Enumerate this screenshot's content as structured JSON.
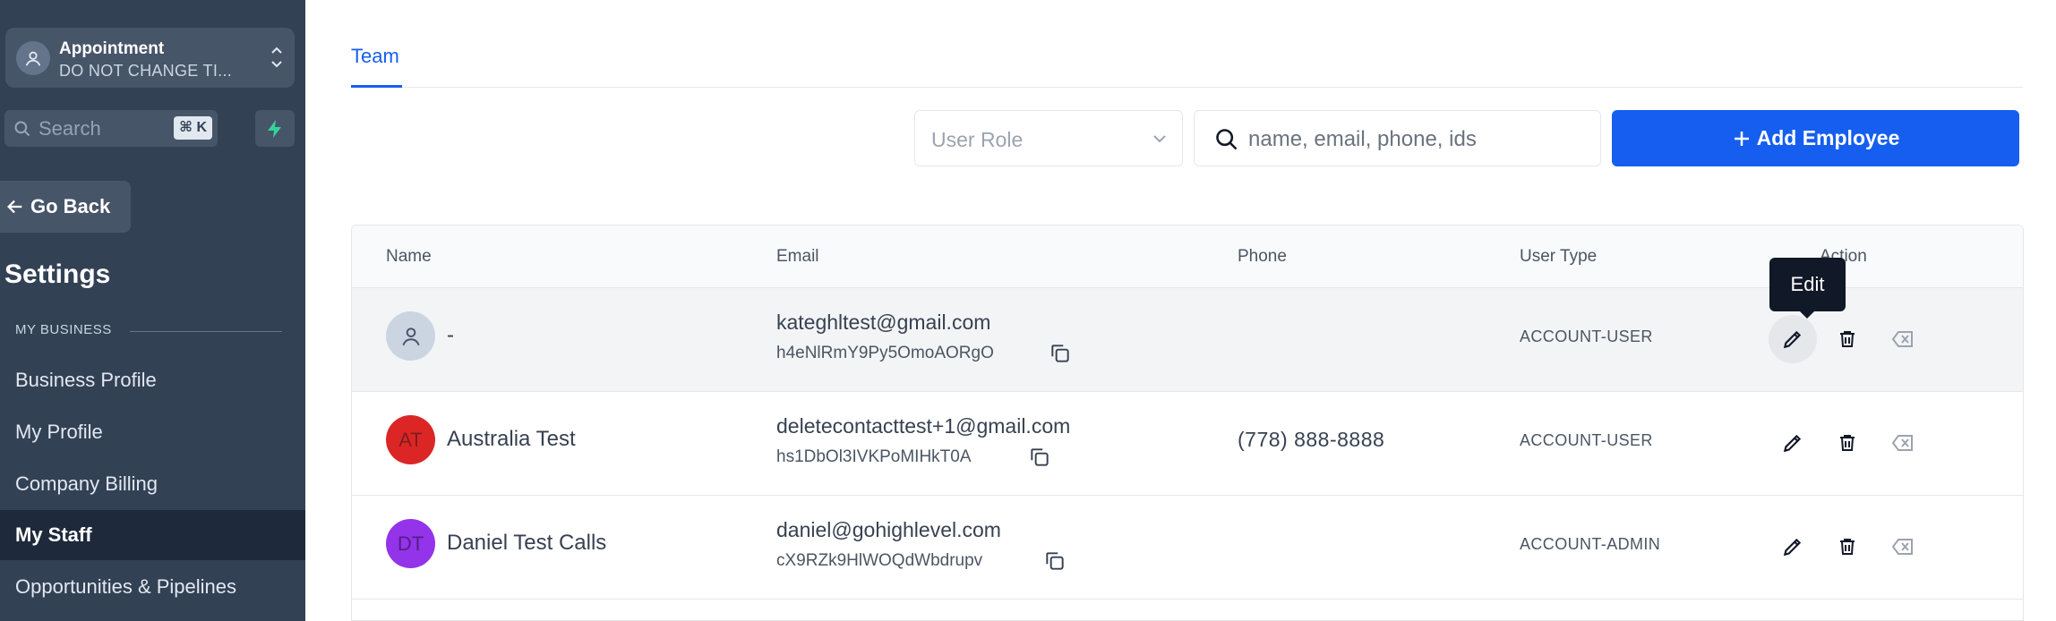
{
  "account": {
    "name": "Appointment",
    "subtitle": "DO NOT CHANGE TI..."
  },
  "search": {
    "placeholder": "Search",
    "shortcut": "⌘ K"
  },
  "nav": {
    "go_back": "Go Back",
    "settings_title": "Settings",
    "section_label": "MY BUSINESS",
    "items": [
      {
        "label": "Business Profile"
      },
      {
        "label": "My Profile"
      },
      {
        "label": "Company Billing"
      },
      {
        "label": "My Staff",
        "active": true
      },
      {
        "label": "Opportunities & Pipelines"
      }
    ]
  },
  "tabs": [
    {
      "label": "Team"
    }
  ],
  "filters": {
    "role_placeholder": "User Role",
    "search_placeholder": "name, email, phone, ids",
    "add_button": "Add Employee"
  },
  "table": {
    "columns": [
      "Name",
      "Email",
      "Phone",
      "User Type",
      "Action"
    ],
    "rows": [
      {
        "initials": "",
        "name": "-",
        "email": "kateghltest@gmail.com",
        "id": "h4eNlRmY9Py5OmoAORgO",
        "phone": "",
        "user_type": "ACCOUNT-USER",
        "avatar_color": "#cbd5e1"
      },
      {
        "initials": "AT",
        "name": "Australia Test",
        "email": "deletecontacttest+1@gmail.com",
        "id": "hs1DbOl3IVKPoMIHkT0A",
        "phone": "(778) 888-8888",
        "user_type": "ACCOUNT-USER",
        "avatar_color": "#dc2626"
      },
      {
        "initials": "DT",
        "name": "Daniel Test Calls",
        "email": "daniel@gohighlevel.com",
        "id": "cX9RZk9HlWOQdWbdrupv",
        "phone": "",
        "user_type": "ACCOUNT-ADMIN",
        "avatar_color": "#9333ea"
      }
    ]
  },
  "tooltip": {
    "text": "Edit"
  },
  "colors": {
    "sidebar": "#334155",
    "accent": "#155eef"
  }
}
